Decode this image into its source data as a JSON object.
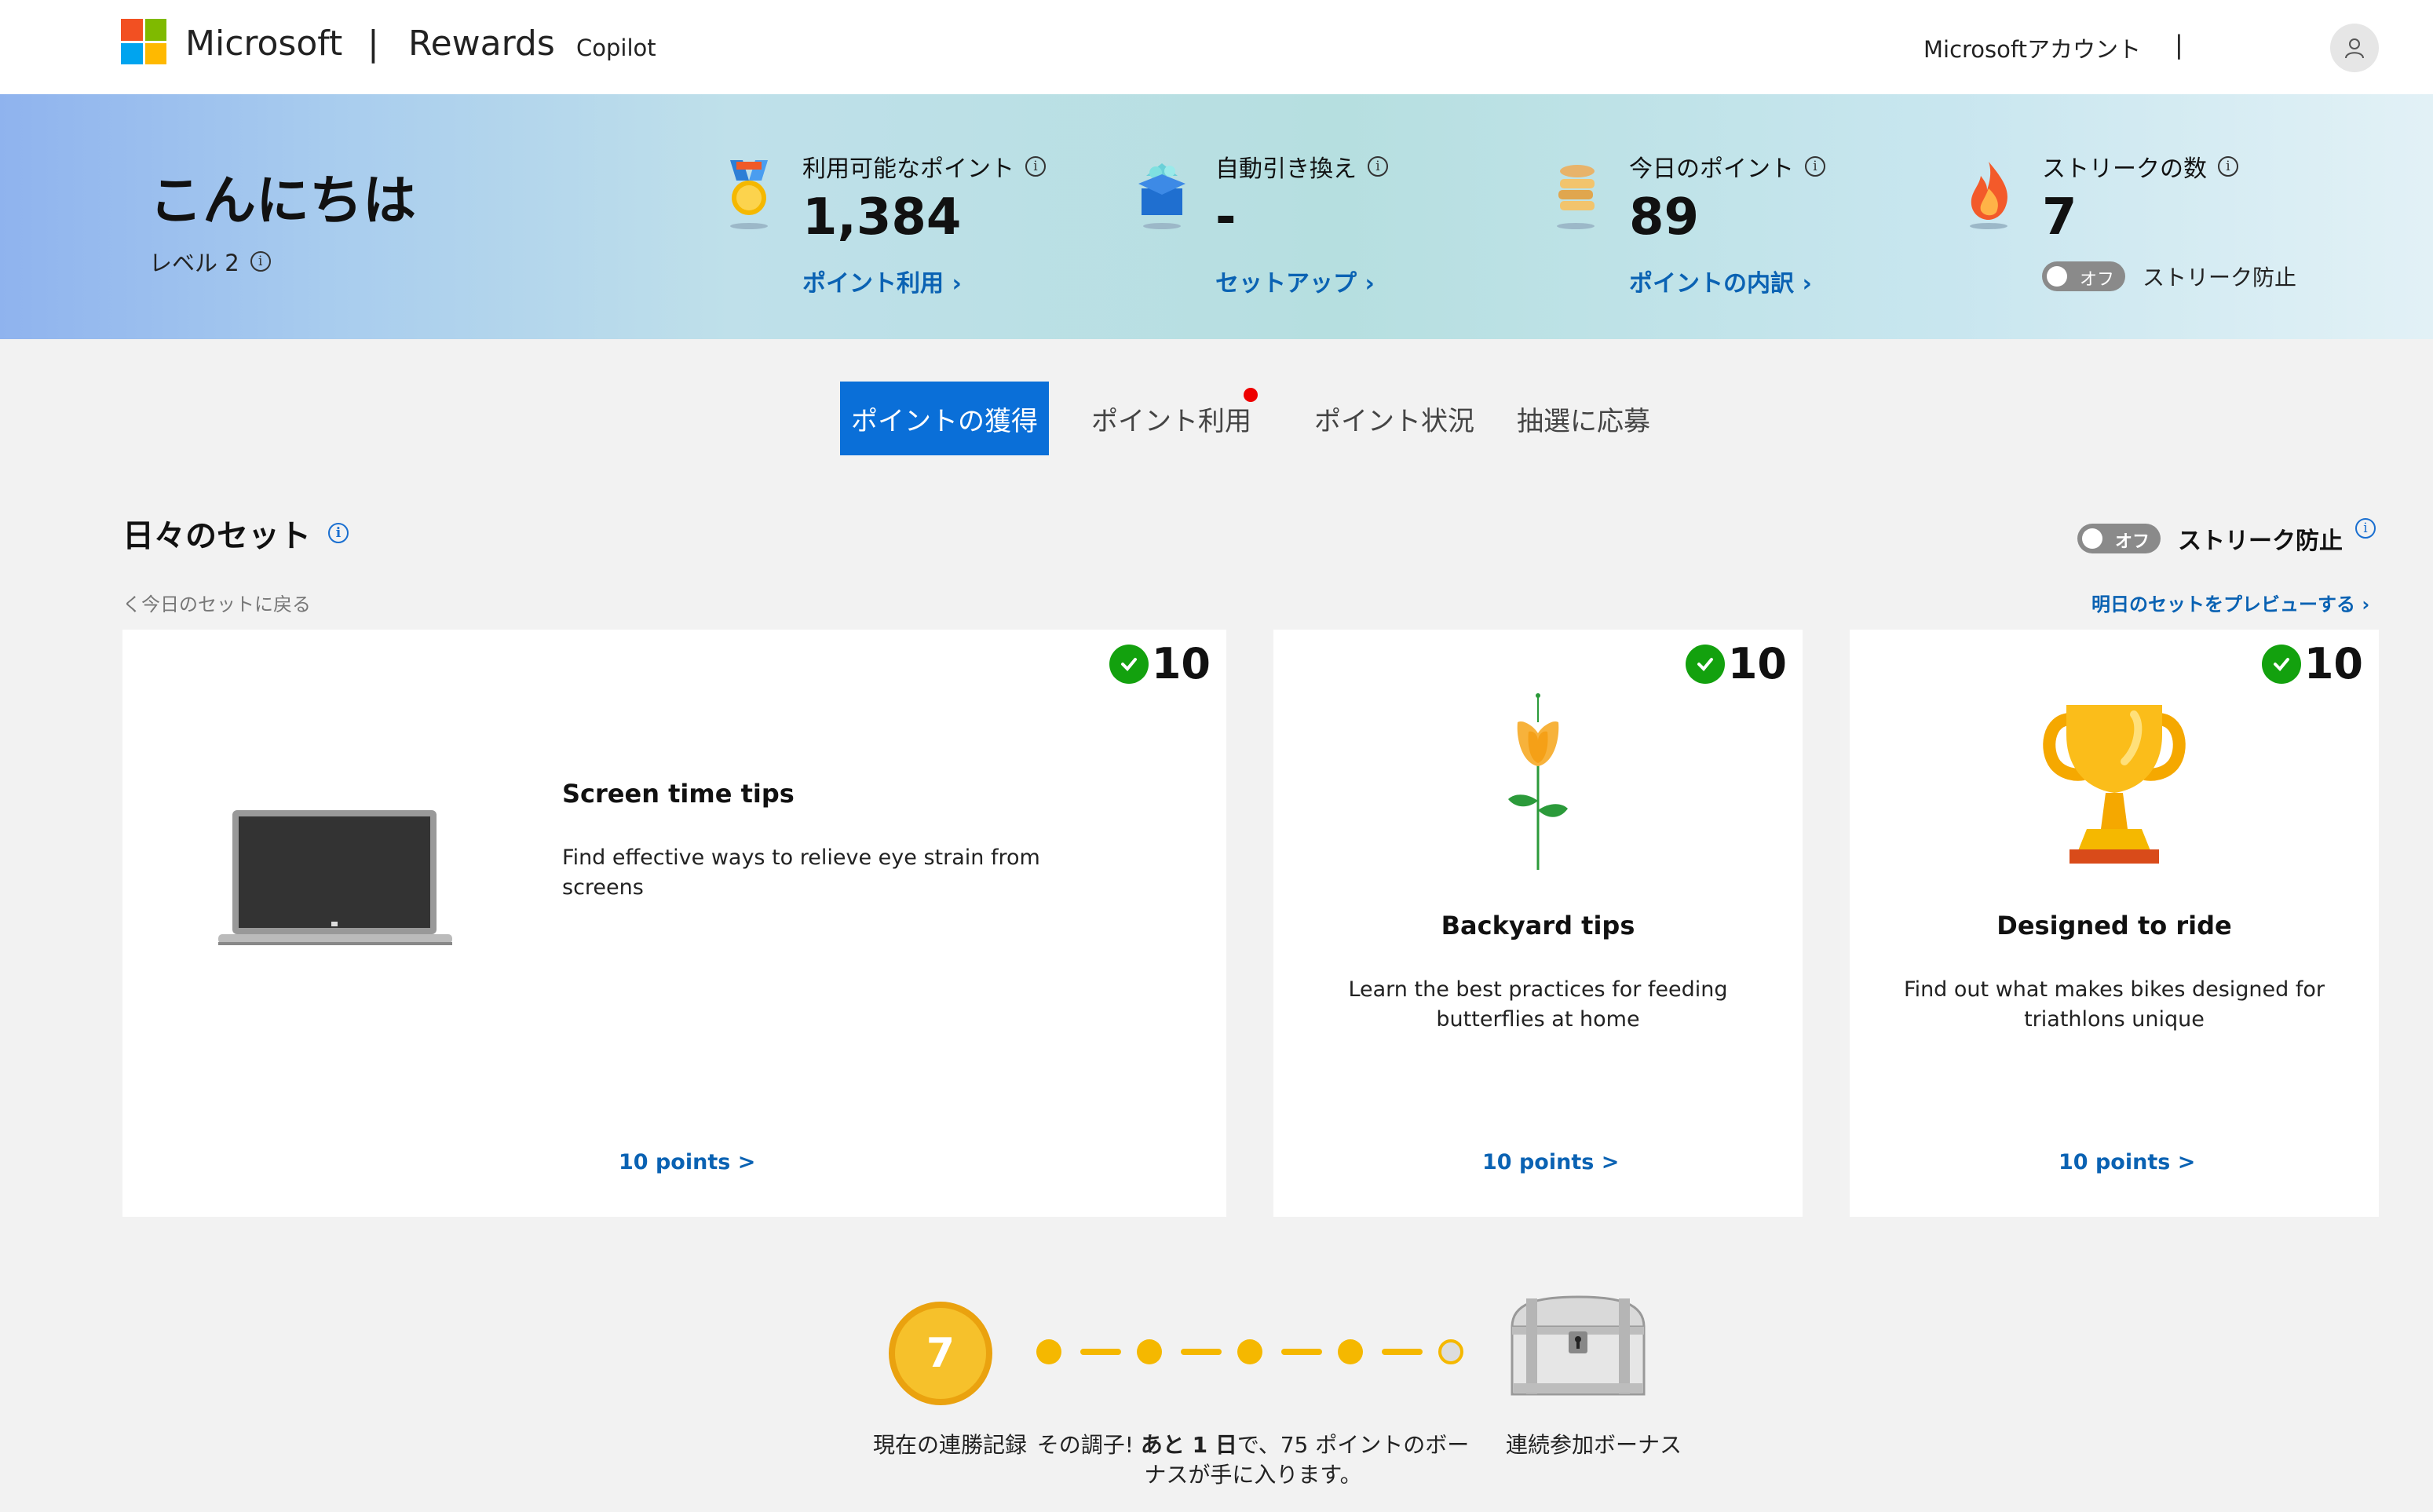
{
  "header": {
    "brand": "Microsoft",
    "separator": "|",
    "product": "Rewards",
    "copilot": "Copilot",
    "account": "Microsoftアカウント",
    "account_separator": "|",
    "avatar_icon": "person-icon"
  },
  "hero": {
    "greeting": "こんにちは",
    "level": "レベル 2",
    "stats": [
      {
        "label": "利用可能なポイント",
        "value": "1,384",
        "link": "ポイント利用 ›",
        "icon": "medal-icon"
      },
      {
        "label": "自動引き換え",
        "value": "-",
        "link": "セットアップ ›",
        "icon": "gift-box-icon"
      },
      {
        "label": "今日のポイント",
        "value": "89",
        "link": "ポイントの内訳 ›",
        "icon": "coin-stack-icon"
      },
      {
        "label": "ストリークの数",
        "value": "7",
        "icon": "flame-icon"
      }
    ],
    "streak_toggle": "オフ",
    "streak_protect": "ストリーク防止"
  },
  "tabs": [
    {
      "label": "ポイントの獲得",
      "active": true
    },
    {
      "label": "ポイント利用",
      "notification": true
    },
    {
      "label": "ポイント状況"
    },
    {
      "label": "抽選に応募"
    }
  ],
  "daily_set": {
    "title": "日々のセット",
    "toggle": "オフ",
    "streak_protect": "ストリーク防止",
    "back_link": "く今日のセットに戻る",
    "preview_link": "明日のセットをプレビューする ›",
    "cards": [
      {
        "points": "10",
        "title": "Screen time tips",
        "desc": "Find effective ways to relieve eye strain from screens",
        "link": "10 points >",
        "icon": "laptop-icon"
      },
      {
        "points": "10",
        "title": "Backyard tips",
        "desc": "Learn the best practices for feeding butterflies at home",
        "link": "10 points >",
        "icon": "flower-icon"
      },
      {
        "points": "10",
        "title": "Designed to ride",
        "desc": "Find out what makes bikes designed for triathlons unique",
        "link": "10 points >",
        "icon": "trophy-icon"
      }
    ]
  },
  "streak": {
    "count": "7",
    "current_label": "現在の連勝記録",
    "message_prefix": "その調子! ",
    "message_bold": "あと 1 日",
    "message_suffix": "で、75 ポイントのボーナスが手に入ります。",
    "bonus_label": "連続参加ボーナス",
    "filled_days": 4,
    "total_days": 5,
    "chest_icon": "treasure-chest-icon"
  },
  "colors": {
    "accent": "#0a6fd8",
    "link": "#0a62b3",
    "check": "#13a10e",
    "streak": "#f5b800",
    "notification": "#e00000"
  }
}
